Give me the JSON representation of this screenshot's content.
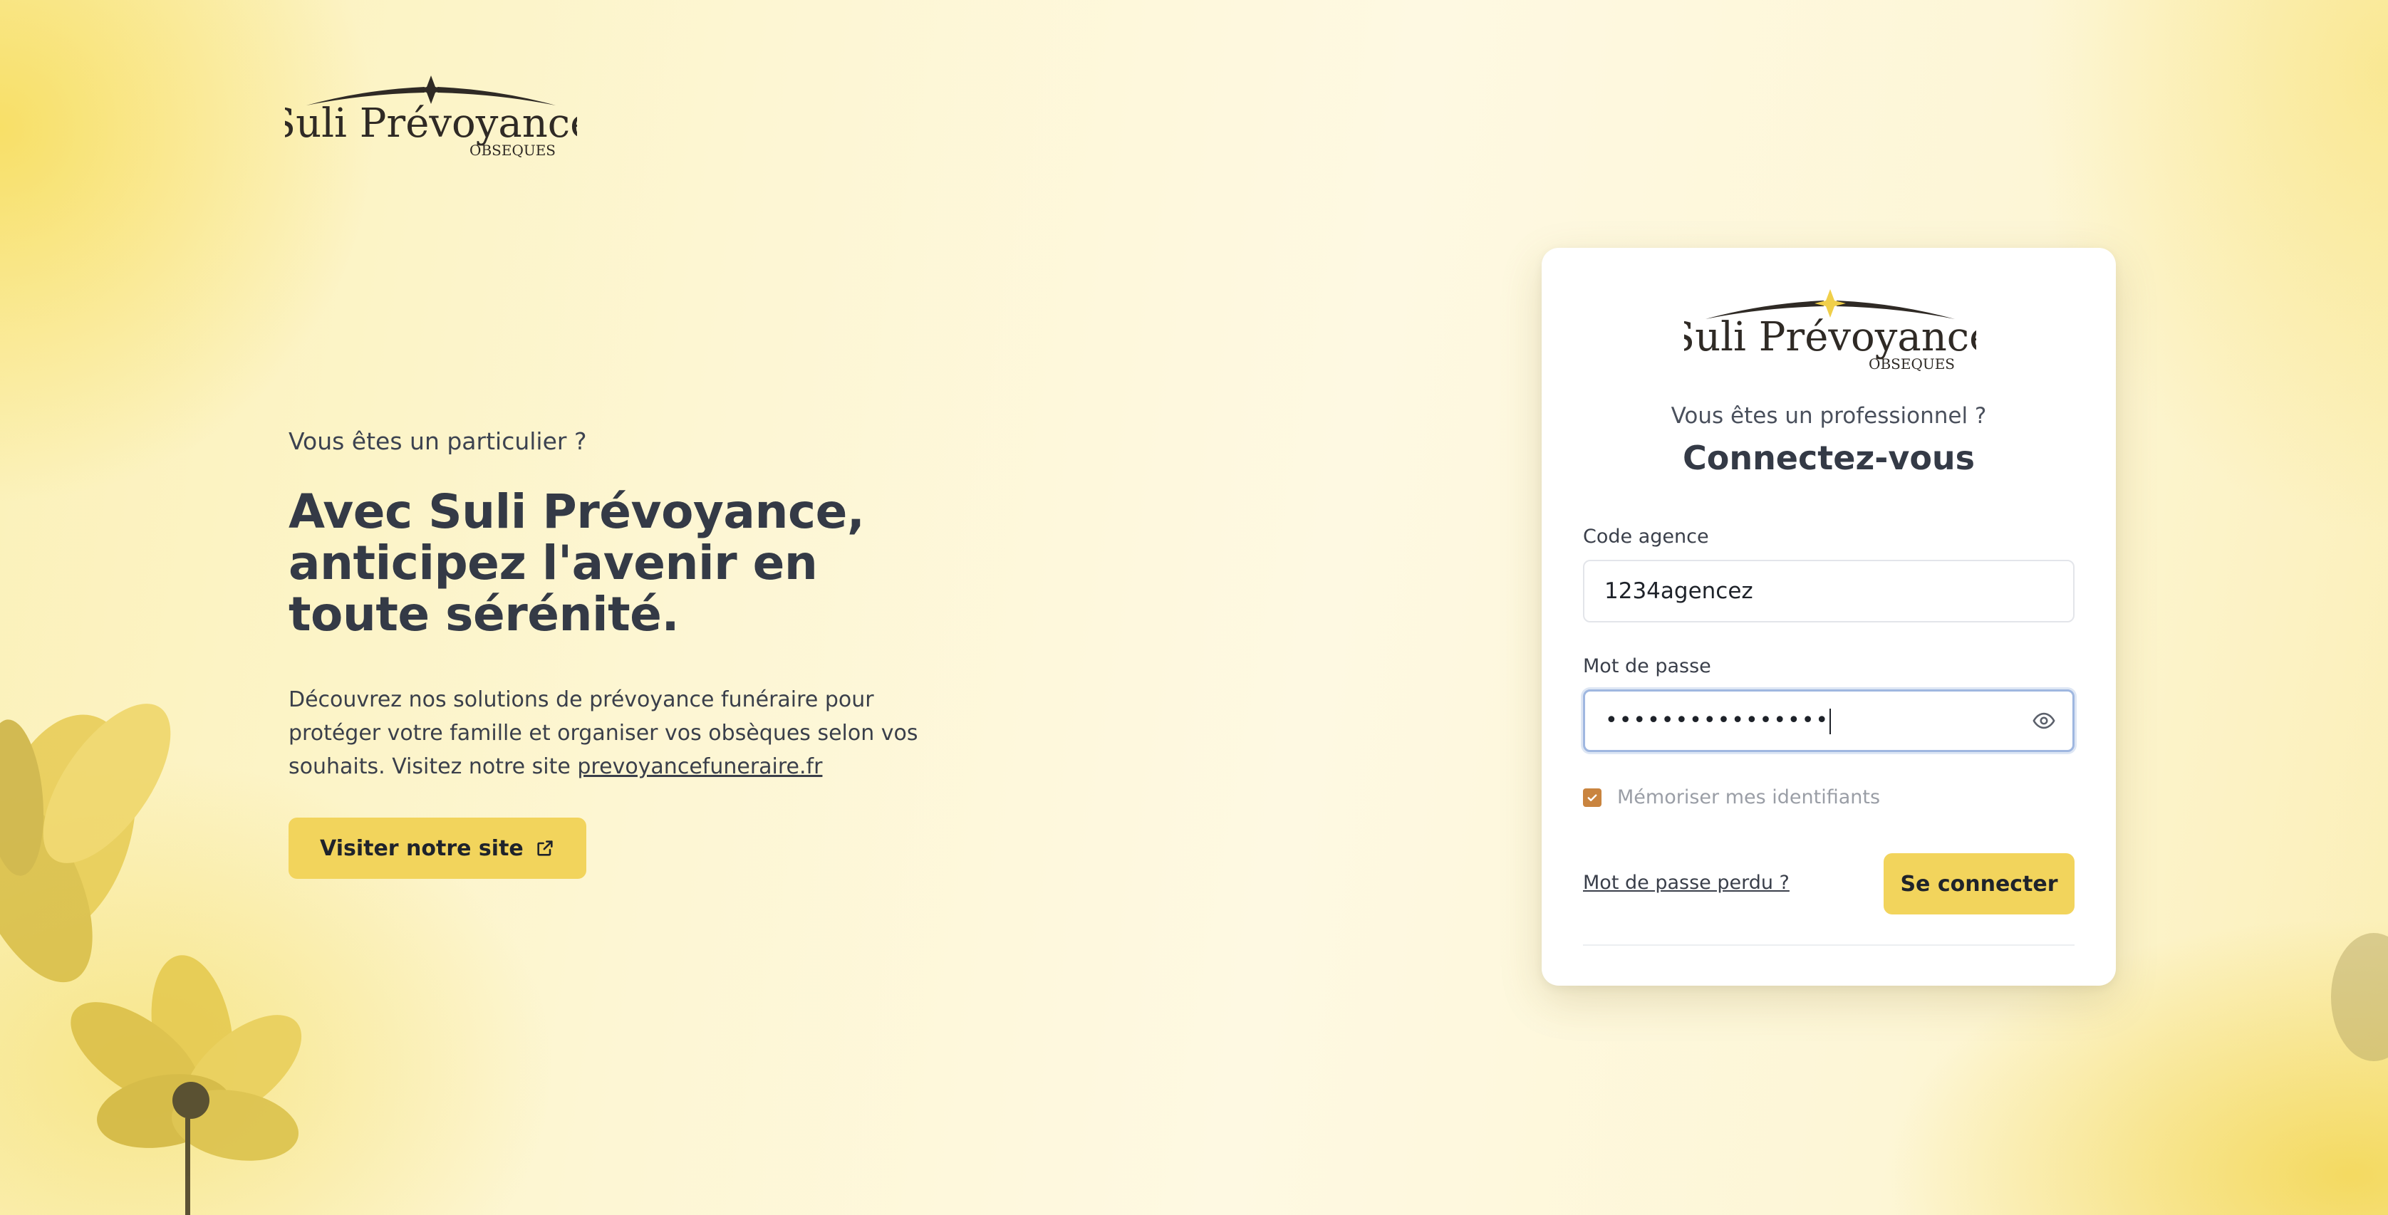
{
  "brand": {
    "name": "Suli Prévoyance",
    "sub": "OBSEQUES"
  },
  "hero": {
    "kicker": "Vous êtes un particulier ?",
    "title": "Avec Suli Prévoyance, anticipez l'avenir en toute sérénité.",
    "text_before_link": "Découvrez nos solutions de prévoyance funéraire pour protéger votre famille et organiser vos obsèques selon vos souhaits. Visitez notre site ",
    "link_text": "prevoyancefuneraire.fr",
    "button_label": "Visiter notre site"
  },
  "login": {
    "kicker": "Vous êtes un professionnel ?",
    "title": "Connectez-vous",
    "code_label": "Code agence",
    "code_value": "1234agencez",
    "password_label": "Mot de passe",
    "password_masked": "••••••••••••••••",
    "remember_label": "Mémoriser mes identifiants",
    "remember_checked": true,
    "forgot_label": "Mot de passe perdu ?",
    "submit_label": "Se connecter"
  },
  "colors": {
    "accent": "#f2d45c",
    "checkbox": "#c9843f",
    "text": "#343a46"
  },
  "icons": {
    "external_link": "external-link-icon",
    "eye": "eye-icon",
    "check": "check-icon"
  }
}
